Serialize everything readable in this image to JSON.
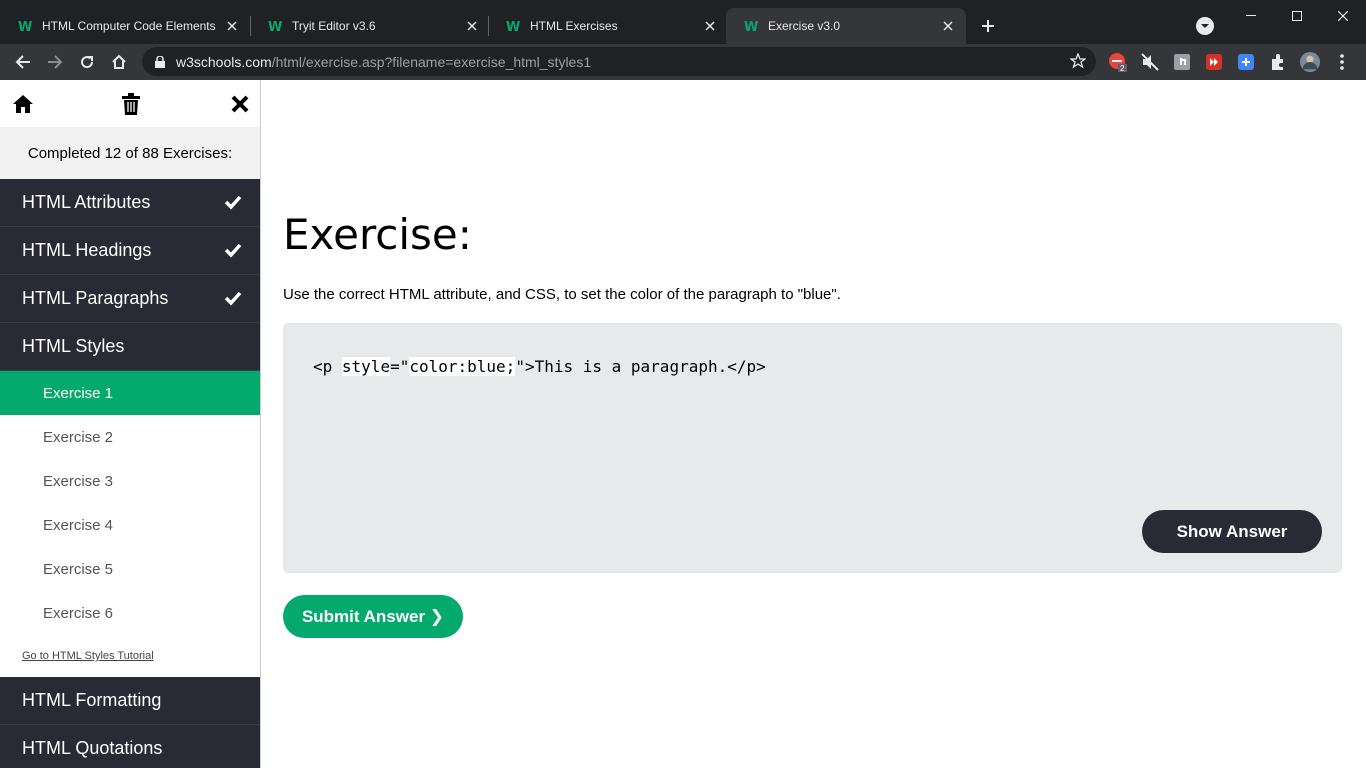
{
  "browser": {
    "tabs": [
      {
        "title": "HTML Computer Code Elements"
      },
      {
        "title": "Tryit Editor v3.6"
      },
      {
        "title": "HTML Exercises"
      },
      {
        "title": "Exercise v3.0"
      }
    ],
    "active_tab_index": 3,
    "url_host": "w3schools.com",
    "url_path": "/html/exercise.asp?filename=exercise_html_styles1",
    "extension_badge": "2"
  },
  "sidebar": {
    "progress_text": "Completed 12 of 88 Exercises:",
    "sections_before": [
      {
        "label": "HTML Attributes",
        "completed": true
      },
      {
        "label": "HTML Headings",
        "completed": true
      },
      {
        "label": "HTML Paragraphs",
        "completed": true
      }
    ],
    "open_section": {
      "label": "HTML Styles"
    },
    "exercises": [
      "Exercise 1",
      "Exercise 2",
      "Exercise 3",
      "Exercise 4",
      "Exercise 5",
      "Exercise 6"
    ],
    "active_exercise_index": 0,
    "tutorial_link": "Go to HTML Styles Tutorial",
    "sections_after": [
      {
        "label": "HTML Formatting"
      },
      {
        "label": "HTML Quotations"
      }
    ]
  },
  "main": {
    "title": "Exercise:",
    "description": "Use the correct HTML attribute, and CSS, to set the color of the paragraph to \"blue\".",
    "code": {
      "part1": "<p ",
      "fill1": "style",
      "part2": "=\"",
      "fill2": "color:blue;",
      "part3": "\">This is a paragraph.</p>"
    },
    "show_answer_label": "Show Answer",
    "submit_label": "Submit Answer ❯"
  },
  "colors": {
    "accent_green": "#04aa6d",
    "sidebar_dark": "#282a35",
    "code_bg": "#e7e9eb"
  }
}
